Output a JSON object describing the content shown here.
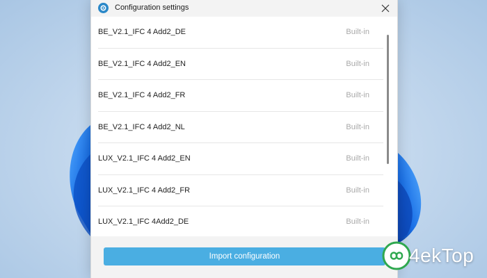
{
  "window": {
    "title": "Configuration settings",
    "app_icon": "settings-app-icon",
    "close_icon": "close-icon"
  },
  "configurations": [
    {
      "name": "BE_V2.1_IFC 4 Add2_DE",
      "status": "Built-in"
    },
    {
      "name": "BE_V2.1_IFC 4 Add2_EN",
      "status": "Built-in"
    },
    {
      "name": "BE_V2.1_IFC 4 Add2_FR",
      "status": "Built-in"
    },
    {
      "name": "BE_V2.1_IFC 4 Add2_NL",
      "status": "Built-in"
    },
    {
      "name": "LUX_V2.1_IFC 4 Add2_EN",
      "status": "Built-in"
    },
    {
      "name": "LUX_V2.1_IFC 4 Add2_FR",
      "status": "Built-in"
    },
    {
      "name": "LUX_V2.1_IFC 4Add2_DE",
      "status": "Built-in"
    }
  ],
  "footer": {
    "import_label": "Import configuration"
  },
  "watermark": {
    "text": "4ekTop"
  },
  "colors": {
    "accent": "#4aaee2",
    "app_icon": "#2b88c8",
    "muted_text": "#a8a8a8"
  }
}
